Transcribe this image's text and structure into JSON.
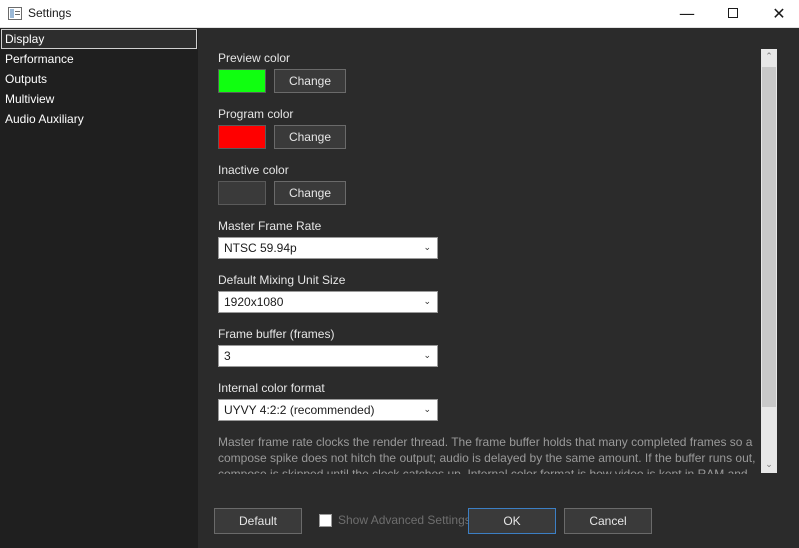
{
  "window": {
    "title": "Settings",
    "minimize_glyph": "—",
    "close_glyph": "✕"
  },
  "sidebar": {
    "items": [
      {
        "label": "Display"
      },
      {
        "label": "Performance"
      },
      {
        "label": "Outputs"
      },
      {
        "label": "Multiview"
      },
      {
        "label": "Audio Auxiliary"
      }
    ]
  },
  "display": {
    "preview": {
      "label": "Preview color",
      "color": "#10ff10",
      "button": "Change"
    },
    "program": {
      "label": "Program color",
      "color": "#ff0000",
      "button": "Change"
    },
    "inactive": {
      "label": "Inactive color",
      "color": "#3a3a3a",
      "button": "Change"
    },
    "frame_rate": {
      "label": "Master Frame Rate",
      "value": "NTSC 59.94p"
    },
    "mixing_size": {
      "label": "Default Mixing Unit Size",
      "value": "1920x1080"
    },
    "frame_buffer": {
      "label": "Frame buffer (frames)",
      "value": "3"
    },
    "color_format": {
      "label": "Internal color format",
      "value": "UYVY 4:2:2 (recommended)"
    },
    "help_text": "Master frame rate clocks the render thread. The frame buffer holds that many completed frames so a compose spike does not hitch the output; audio is delayed by the same amount. If the buffer runs out, compose is skipped until the clock catches up. Internal color format is how video is kept in RAM and",
    "dropdown_glyph": "⌄"
  },
  "scrollbar": {
    "up_glyph": "⌃",
    "down_glyph": "⌄"
  },
  "footer": {
    "default_label": "Default",
    "advanced_label": "Show Advanced Settings",
    "ok_label": "OK",
    "cancel_label": "Cancel",
    "advanced_checked": false
  }
}
